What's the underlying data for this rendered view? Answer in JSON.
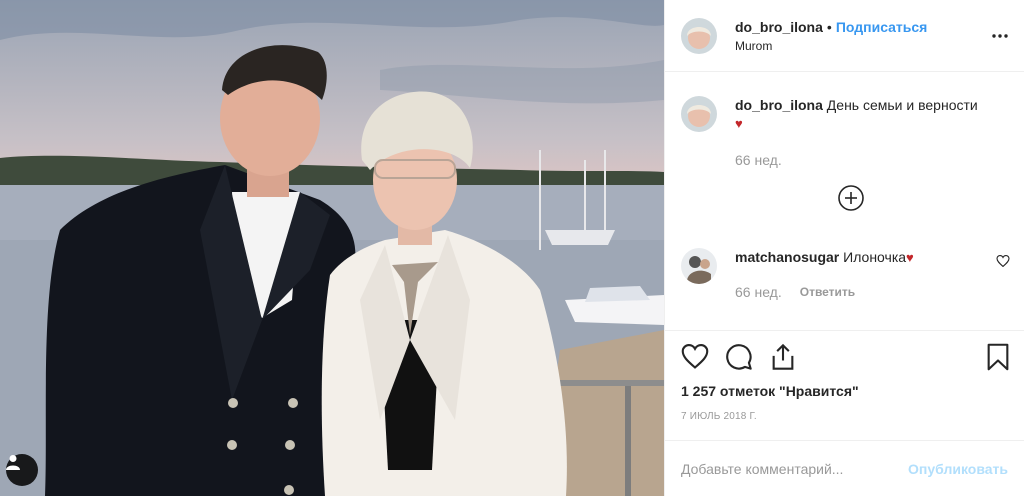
{
  "header": {
    "username": "do_bro_ilona",
    "separator": "•",
    "follow_label": "Подписаться",
    "location": "Murom"
  },
  "caption": {
    "username": "do_bro_ilona",
    "text": "День семьи и верности",
    "heart": "♥",
    "age": "66 нед."
  },
  "comment": {
    "username": "matchanosugar",
    "text": "Илоночка",
    "heart": "♥",
    "age": "66 нед.",
    "reply_label": "Ответить"
  },
  "post": {
    "likes_label": "1 257 отметок \"Нравится\"",
    "date": "7 ИЮЛЬ 2018 Г."
  },
  "add_comment": {
    "placeholder": "Добавьте комментарий...",
    "publish_label": "Опубликовать"
  },
  "colors": {
    "accent": "#3897f0",
    "publish_disabled": "#b2dffc",
    "heart": "#c3272b",
    "meta": "#999999"
  },
  "icons": [
    "user-tag-icon",
    "more-options-icon",
    "load-more-icon",
    "like-icon",
    "comment-icon",
    "share-icon",
    "save-icon",
    "small-heart-icon"
  ]
}
